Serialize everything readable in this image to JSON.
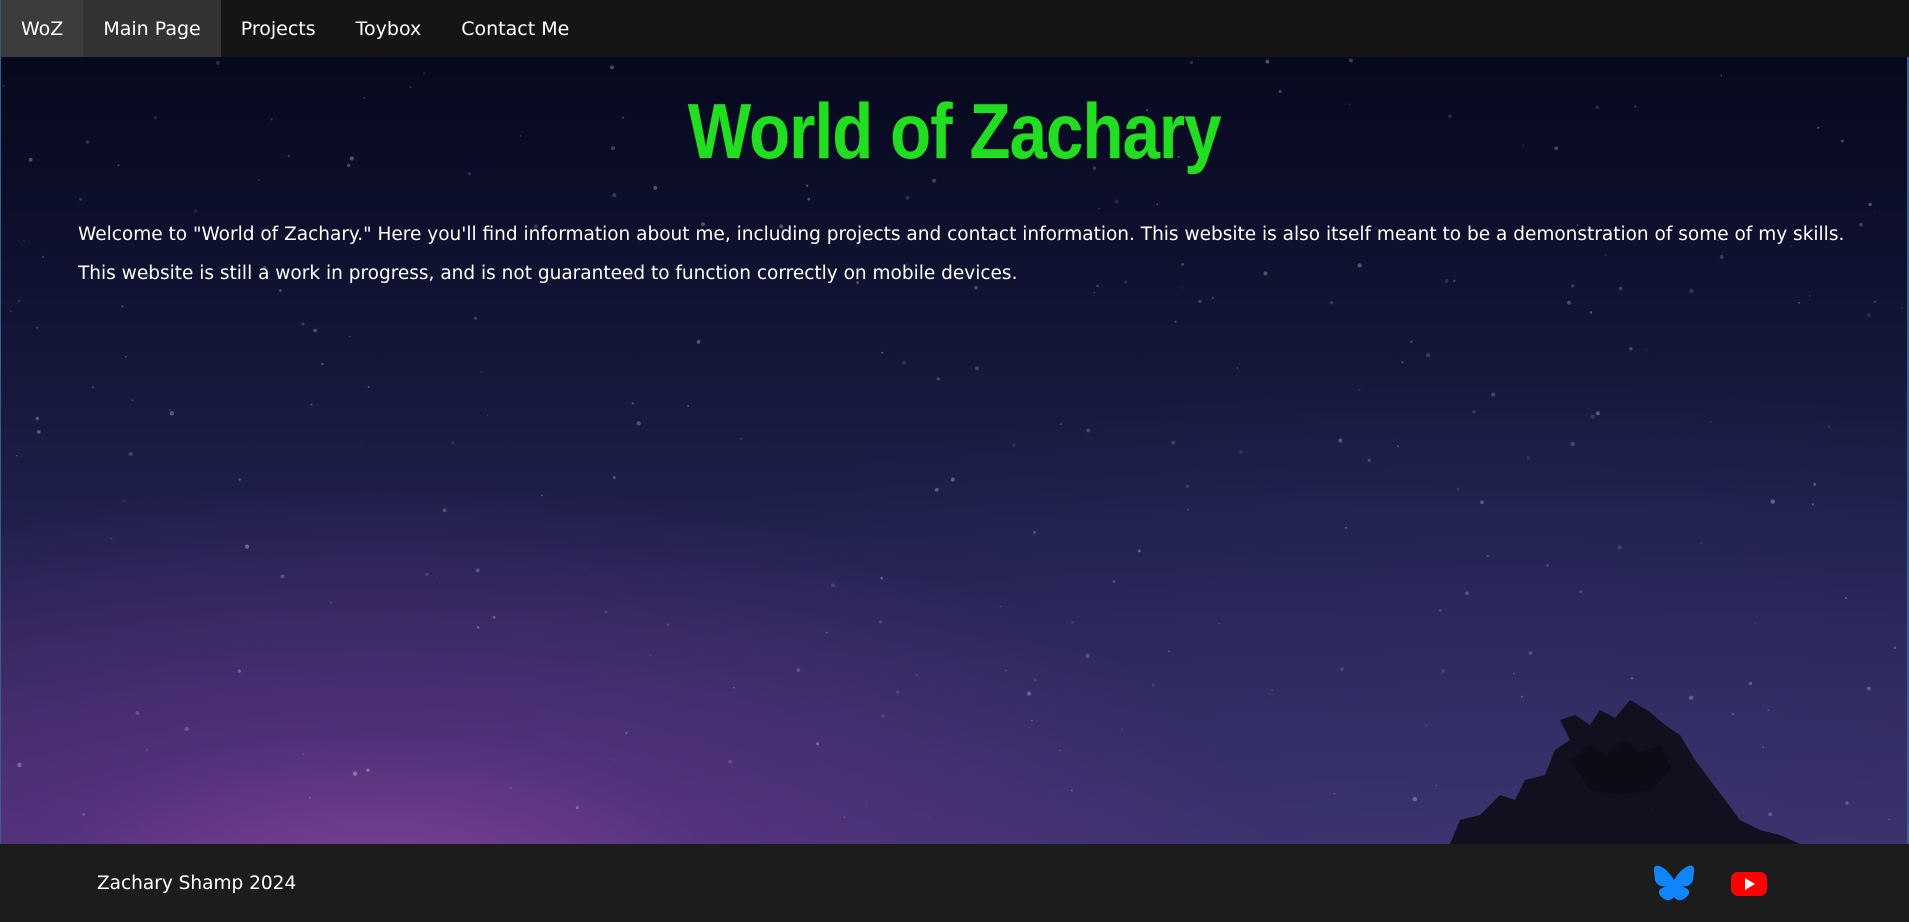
{
  "nav": {
    "brand": "WoZ",
    "items": [
      {
        "label": "Main Page",
        "active": true
      },
      {
        "label": "Projects",
        "active": false
      },
      {
        "label": "Toybox",
        "active": false
      },
      {
        "label": "Contact Me",
        "active": false
      }
    ]
  },
  "main": {
    "title": "World of Zachary",
    "paragraphs": [
      "Welcome to \"World of Zachary.\" Here you'll find information about me, including projects and contact information. This website is also itself meant to be a demonstration of some of my skills.",
      "This website is still a work in progress, and is not guaranteed to function correctly on mobile devices."
    ]
  },
  "footer": {
    "copyright": "Zachary Shamp 2024",
    "social": [
      {
        "icon": "bluesky-icon",
        "color": "#1185fe"
      },
      {
        "icon": "youtube-icon",
        "color": "#ff0000"
      }
    ]
  },
  "colors": {
    "title": "#22dd22",
    "navbar": "#151515",
    "footer": "#1c1c1c",
    "text": "#ffffff"
  }
}
